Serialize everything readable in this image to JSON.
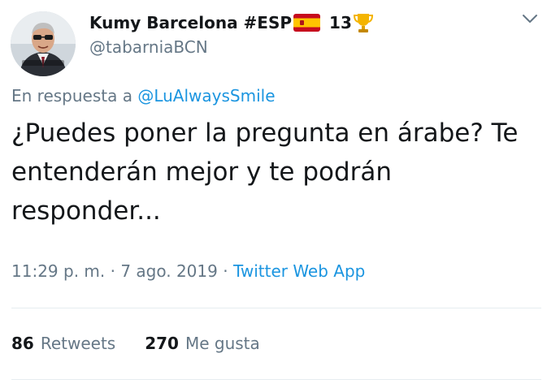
{
  "author": {
    "display_name": "Kumy Barcelona #ESP",
    "flag_icon": "spain-flag-icon",
    "number": "13",
    "trophy_icon": "trophy-icon",
    "handle": "@tabarniaBCN"
  },
  "reply": {
    "prefix": "En respuesta a",
    "mention": "@LuAlwaysSmile"
  },
  "tweet": {
    "text": "¿Puedes poner la pregunta en árabe? Te entenderán mejor y te podrán responder..."
  },
  "meta": {
    "timestamp": "11:29 p. m. · 7 ago. 2019",
    "separator": "·",
    "source": "Twitter Web App"
  },
  "stats": {
    "retweets_count": "86",
    "retweets_label": "Retweets",
    "likes_count": "270",
    "likes_label": "Me gusta"
  },
  "colors": {
    "text": "#14171a",
    "secondary": "#657786",
    "link": "#1b95e0",
    "divider": "#e6ecf0"
  }
}
